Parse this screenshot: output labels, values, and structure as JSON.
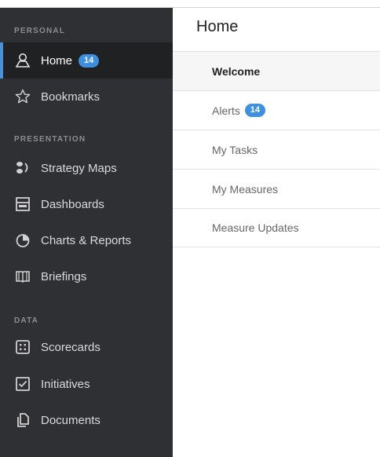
{
  "sidebar": {
    "sections": [
      {
        "label": "PERSONAL"
      },
      {
        "label": "PRESENTATION"
      },
      {
        "label": "DATA"
      }
    ],
    "items": [
      {
        "label": "Home",
        "badge": "14",
        "icon": "user-icon"
      },
      {
        "label": "Bookmarks",
        "icon": "star-icon"
      },
      {
        "label": "Strategy Maps",
        "icon": "strategy-map-icon"
      },
      {
        "label": "Dashboards",
        "icon": "dashboard-icon"
      },
      {
        "label": "Charts & Reports",
        "icon": "pie-chart-icon"
      },
      {
        "label": "Briefings",
        "icon": "book-icon"
      },
      {
        "label": "Scorecards",
        "icon": "scorecard-icon"
      },
      {
        "label": "Initiatives",
        "icon": "checkbox-icon"
      },
      {
        "label": "Documents",
        "icon": "document-icon"
      }
    ]
  },
  "main": {
    "title": "Home",
    "subnav": [
      {
        "label": "Welcome"
      },
      {
        "label": "Alerts",
        "badge": "14"
      },
      {
        "label": "My Tasks"
      },
      {
        "label": "My Measures"
      },
      {
        "label": "Measure Updates"
      }
    ]
  },
  "colors": {
    "accent": "#4a90d9",
    "badge": "#3d8fe0",
    "sidebar": "#2e3033"
  }
}
